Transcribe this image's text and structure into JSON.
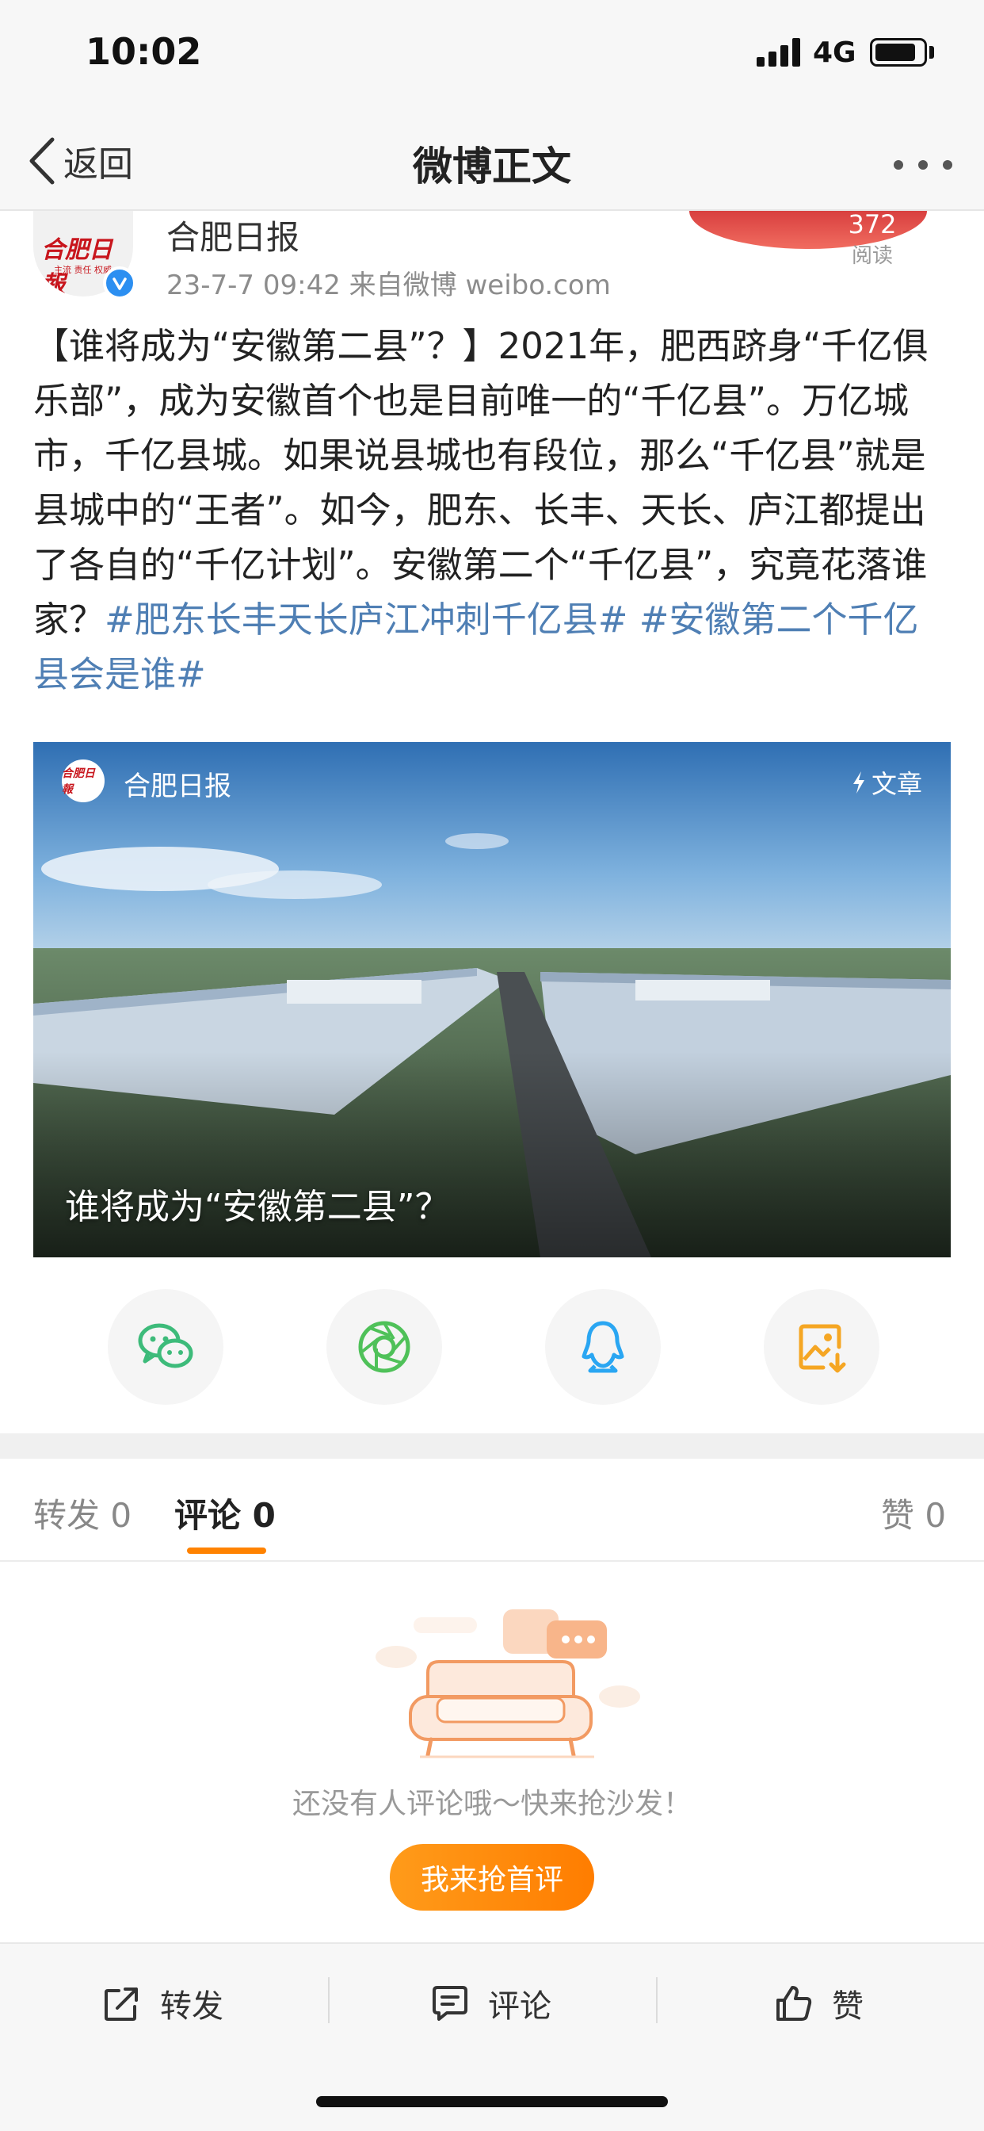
{
  "status_bar": {
    "time": "10:02",
    "network": "4G"
  },
  "nav": {
    "back_label": "返回",
    "title": "微博正文"
  },
  "post": {
    "author": "合肥日报",
    "meta": "23-7-7 09:42  来自微博 weibo.com",
    "read_count": "372",
    "read_label": "阅读",
    "avatar_logo_text": "合肥日報",
    "avatar_sub_text": "主流 责任 权威",
    "body_text": "【谁将成为“安徽第二县”？】2021年，肥西跻身“千亿俱乐部”，成为安徽首个也是目前唯一的“千亿县”。万亿城市，千亿县城。如果说县城也有段位，那么“千亿县”就是县城中的“王者”。如今，肥东、长丰、天长、庐江都提出了各自的“千亿计划”。安徽第二个“千亿县”，究竟花落谁家？",
    "topics": [
      "#肥东长丰天长庐江冲刺千亿县#",
      "#安徽第二个千亿县会是谁#"
    ]
  },
  "article_card": {
    "source": "合肥日报",
    "type_label": "文章",
    "title": "谁将成为“安徽第二县”？",
    "logo_text": "合肥日報"
  },
  "share": [
    {
      "name": "wechat-share-button",
      "icon": "wechat-icon",
      "color": "#3dbb7a"
    },
    {
      "name": "moments-share-button",
      "icon": "aperture-icon",
      "color": "#4fc159"
    },
    {
      "name": "qq-share-button",
      "icon": "qq-penguin-icon",
      "color": "#2aa6f2"
    },
    {
      "name": "save-image-button",
      "icon": "image-download-icon",
      "color": "#f5a623"
    }
  ],
  "tabs": {
    "repost": "转发 0",
    "comment": "评论 0",
    "like": "赞 0"
  },
  "empty_state": {
    "text": "还没有人评论哦～快来抢沙发！",
    "button": "我来抢首评"
  },
  "bottom_actions": {
    "repost": "转发",
    "comment": "评论",
    "like": "赞"
  },
  "colors": {
    "accent": "#ff8200",
    "topic": "#4f7fb4",
    "verified": "#2c8ff1"
  }
}
